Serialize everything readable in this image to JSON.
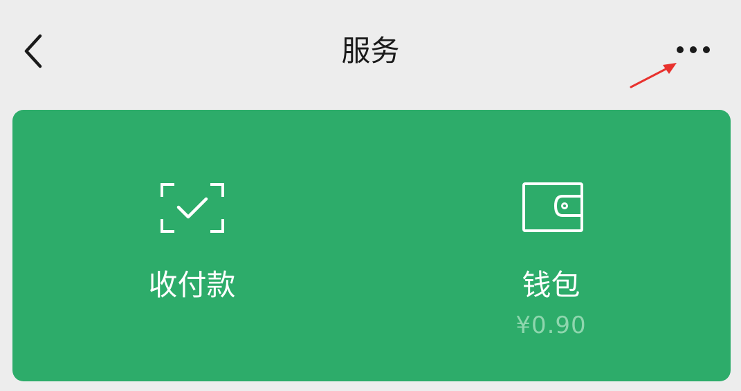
{
  "header": {
    "title": "服务"
  },
  "icons": {
    "back": "chevron-left-icon",
    "more": "more-horizontal-icon",
    "pay": "scan-check-icon",
    "wallet": "wallet-icon"
  },
  "services": {
    "pay_label": "收付款",
    "wallet_label": "钱包",
    "wallet_balance": "¥0.90"
  },
  "colors": {
    "background": "#ededed",
    "card": "#2dac6a",
    "balance_text": "#8fd6ae",
    "annotation_arrow": "#e8322e"
  }
}
